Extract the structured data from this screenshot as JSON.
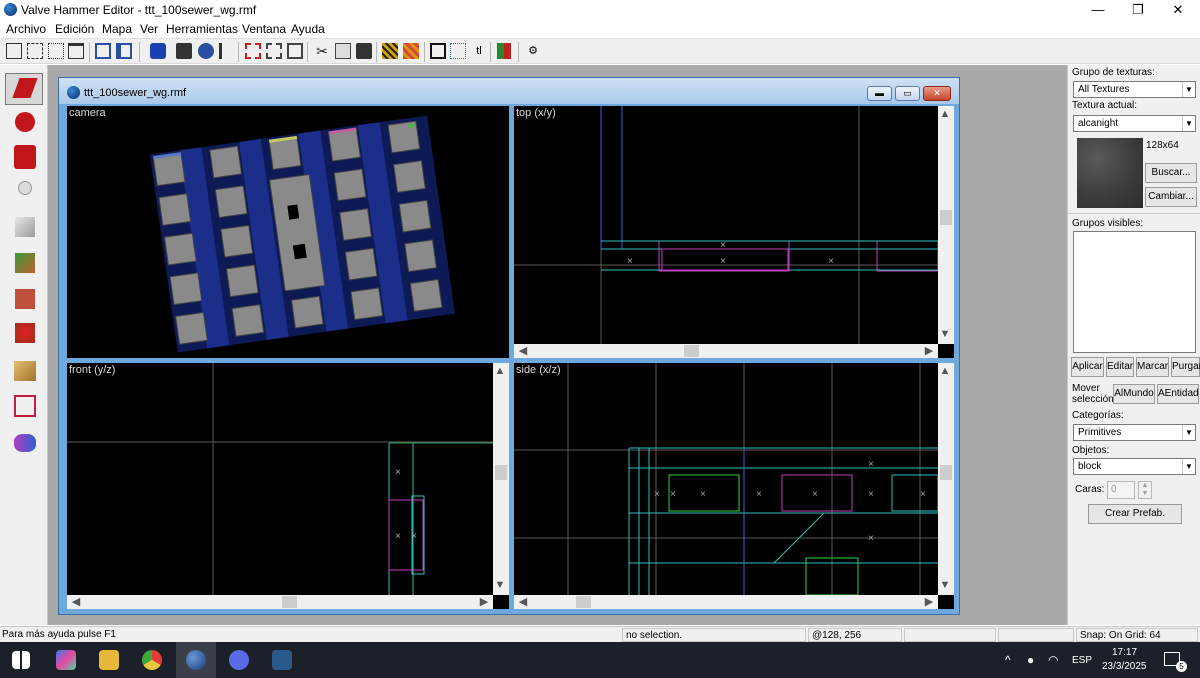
{
  "window": {
    "title": "Valve Hammer Editor - ttt_100sewer_wg.rmf",
    "minimize": "—",
    "maximize": "❐",
    "close": "✕"
  },
  "menu": [
    "Archivo",
    "Edición",
    "Mapa",
    "Ver",
    "Herramientas",
    "Ventana",
    "Ayuda"
  ],
  "document": {
    "title": "ttt_100sewer_wg.rmf",
    "min": "▬",
    "max": "▭",
    "close": "✕",
    "viewports": {
      "camera": "camera",
      "top": "top (x/y)",
      "front": "front (y/z)",
      "side": "side (x/z)"
    }
  },
  "panel": {
    "texture_group_label": "Grupo de texturas:",
    "texture_group_value": "All Textures",
    "current_texture_label": "Textura actual:",
    "current_texture_value": "alcanight",
    "texture_size": "128x64",
    "browse_button": "Buscar...",
    "replace_button": "Cambiar...",
    "visgroups_label": "Grupos visibles:",
    "apply_button": "Aplicar",
    "edit_button": "Editar",
    "mark_button": "Marcar",
    "purge_button": "Purgar",
    "move_selection_label": "Mover selección:",
    "to_world_button": "AlMundo",
    "to_entity_button": "AEntidad",
    "categories_label": "Categorías:",
    "categories_value": "Primitives",
    "objects_label": "Objetos:",
    "objects_value": "block",
    "faces_label": "Caras:",
    "faces_value": "0",
    "create_prefab_button": "Crear Prefab."
  },
  "status": {
    "help": "Para más ayuda pulse F1",
    "selection": "no selection.",
    "coords": "@128, 256",
    "snap": "Snap: On Grid: 64"
  },
  "taskbar": {
    "lang": "ESP",
    "time": "17:17",
    "date": "23/3/2025",
    "notifications": "5"
  }
}
